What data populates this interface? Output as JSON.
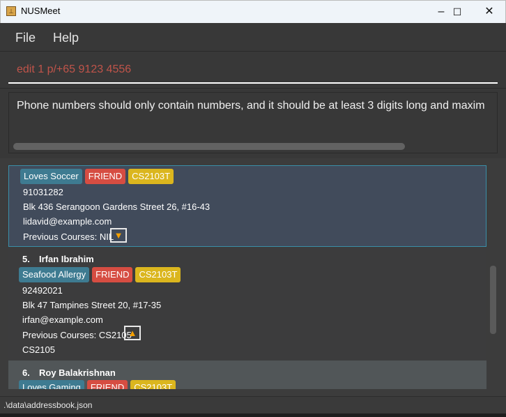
{
  "window": {
    "title": "NUSMeet",
    "icon": "app-icon",
    "controls": {
      "minimize": "–",
      "maximize": "☐",
      "close": "✕"
    }
  },
  "menu": [
    "File",
    "Help"
  ],
  "command_box": {
    "value": "edit 1 p/+65 9123 4556",
    "color": "#c0544a"
  },
  "result": "Phone numbers should only contain numbers, and it should be at least 3 digits long and maxim",
  "persons": [
    {
      "index": "",
      "name": "",
      "tags": [
        "Loves Soccer",
        "FRIEND",
        "CS2103T"
      ],
      "phone": "91031282",
      "address": "Blk 436 Serangoon Gardens Street 26, #16-43",
      "email": "lidavid@example.com",
      "courses_label": "Previous Courses: NIL",
      "toggle": "▼",
      "expanded": []
    },
    {
      "index": "5.",
      "name": "Irfan Ibrahim",
      "tags": [
        "Seafood Allergy",
        "FRIEND",
        "CS2103T"
      ],
      "phone": "92492021",
      "address": "Blk 47 Tampines Street 20, #17-35",
      "email": "irfan@example.com",
      "courses_label": "Previous Courses: CS2105",
      "toggle": "▲",
      "expanded": [
        "CS2105"
      ]
    },
    {
      "index": "6.",
      "name": "Roy Balakrishnan",
      "tags": [
        "Loves Gaming",
        "FRIEND",
        "CS2103T"
      ]
    }
  ],
  "tag_colors": {
    "hobby": "#3e7b91",
    "friend": "#d64d42",
    "course": "#dbb61e"
  },
  "status": ".\\data\\addressbook.json"
}
